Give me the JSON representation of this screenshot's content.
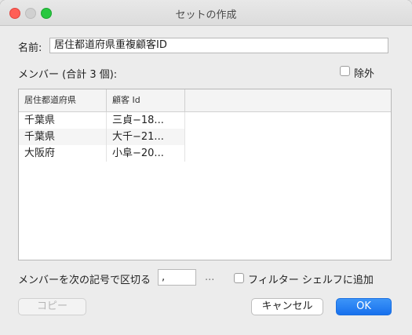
{
  "window": {
    "title": "セットの作成"
  },
  "name": {
    "label": "名前:",
    "value": "居住都道府県重複顧客ID"
  },
  "members": {
    "label": "メンバー (合計 3 個):",
    "exclude_label": "除外",
    "columns": [
      "居住都道府県",
      "顧客 Id"
    ],
    "rows": [
      [
        "千葉県",
        "三貞−18..."
      ],
      [
        "千葉県",
        "大千−21..."
      ],
      [
        "大阪府",
        "小阜−20..."
      ]
    ]
  },
  "separator": {
    "label": "メンバーを次の記号で区切る",
    "value": ",",
    "ellipsis": "..."
  },
  "filter_shelf": {
    "label": "フィルター シェルフに追加"
  },
  "buttons": {
    "copy": "コピー",
    "cancel": "キャンセル",
    "ok": "OK"
  },
  "colors": {
    "accent": "#1a74f0",
    "close": "#ff5f57",
    "maximize": "#28c840"
  }
}
